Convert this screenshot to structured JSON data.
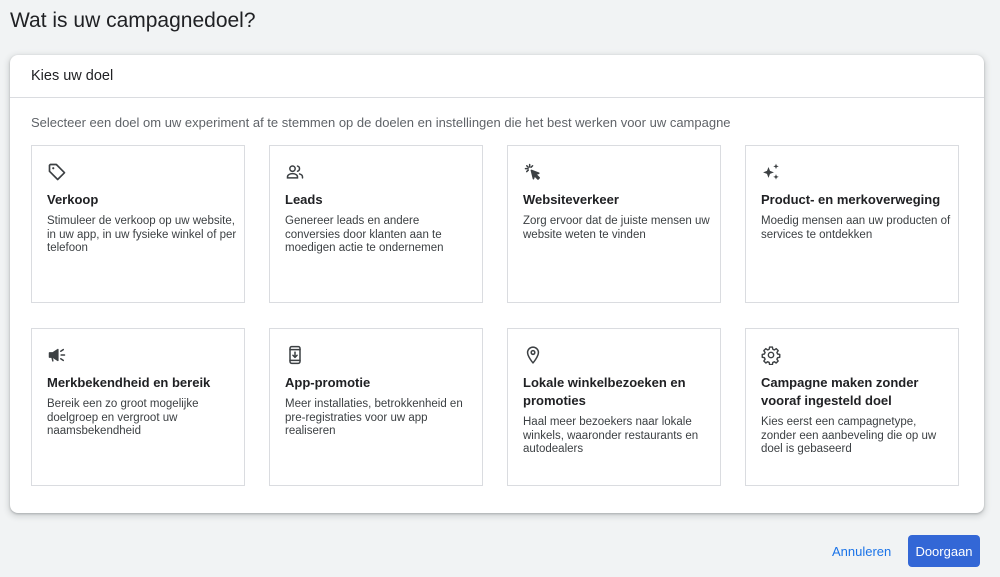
{
  "page": {
    "title": "Wat is uw campagnedoel?"
  },
  "panel": {
    "header": "Kies uw doel",
    "subtitle": "Selecteer een doel om uw experiment af te stemmen op de doelen en instellingen die het best werken voor uw campagne"
  },
  "goals": [
    {
      "icon": "tag-icon",
      "title": "Verkoop",
      "description": "Stimuleer de verkoop op uw website, in uw app, in uw fysieke winkel of per telefoon"
    },
    {
      "icon": "people-icon",
      "title": "Leads",
      "description": "Genereer leads en andere conversies door klanten aan te moedigen actie te ondernemen"
    },
    {
      "icon": "click-cursor-icon",
      "title": "Websiteverkeer",
      "description": "Zorg ervoor dat de juiste mensen uw website weten te vinden"
    },
    {
      "icon": "sparkle-icon",
      "title": "Product- en merkoverweging",
      "description": "Moedig mensen aan uw producten of services te ontdekken"
    },
    {
      "icon": "megaphone-icon",
      "title": "Merkbekendheid en bereik",
      "description": "Bereik een zo groot mogelijke doelgroep en vergroot uw naamsbekendheid"
    },
    {
      "icon": "phone-download-icon",
      "title": "App-promotie",
      "description": "Meer installaties, betrokkenheid en pre-registraties voor uw app realiseren"
    },
    {
      "icon": "location-pin-icon",
      "title": "Lokale winkelbezoeken en promoties",
      "description": "Haal meer bezoekers naar lokale winkels, waaronder restaurants en autodealers"
    },
    {
      "icon": "gear-icon",
      "title": "Campagne maken zonder vooraf ingesteld doel",
      "description": "Kies eerst een campagnetype, zonder een aanbeveling die op uw doel is gebaseerd"
    }
  ],
  "footer": {
    "cancel_label": "Annuleren",
    "continue_label": "Doorgaan"
  },
  "colors": {
    "accent": "#1a73e8",
    "primary_button": "#3367d6",
    "background": "#f1f3f4",
    "border": "#dadce0"
  }
}
